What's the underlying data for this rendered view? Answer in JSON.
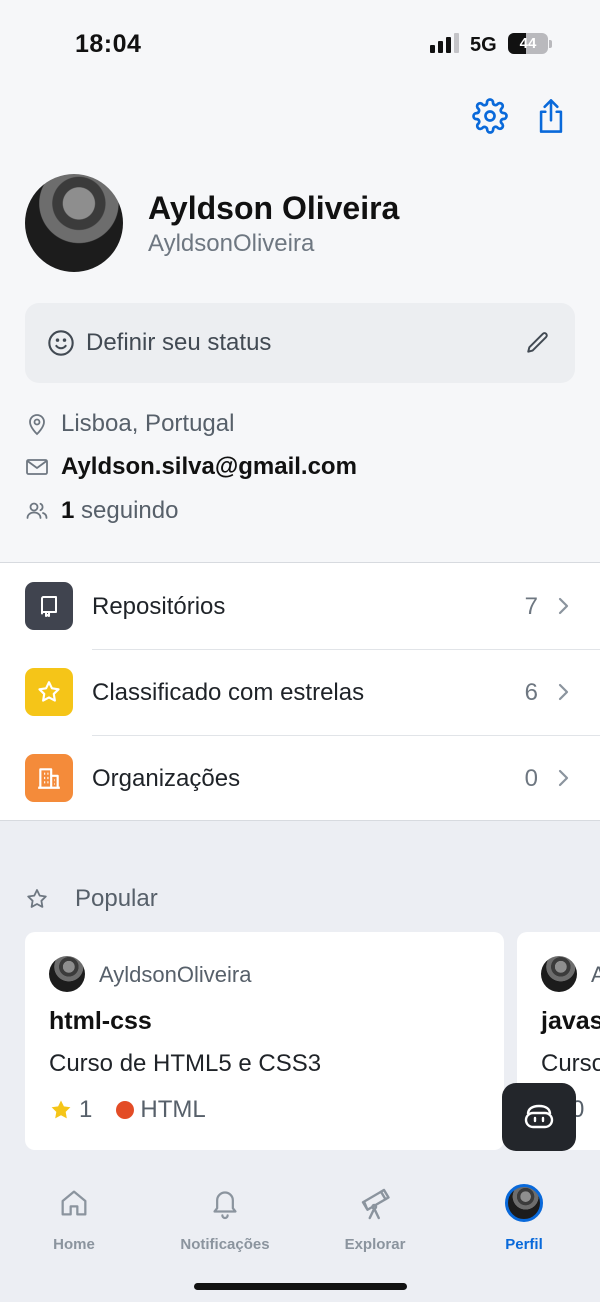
{
  "status_bar": {
    "time": "18:04",
    "network": "5G",
    "battery": "44",
    "battery_level": 0.44
  },
  "colors": {
    "accent": "#0969da",
    "repo_tile": "#40444f",
    "star_tile": "#f5c518",
    "org_tile": "#f48b3a",
    "html_lang": "#e34c26"
  },
  "toolbar": {
    "settings_icon": "gear-icon",
    "share_icon": "share-icon"
  },
  "profile": {
    "name": "Ayldson Oliveira",
    "login": "AyldsonOliveira",
    "status_placeholder": "Definir seu status",
    "location": "Lisboa, Portugal",
    "email": "Ayldson.silva@gmail.com",
    "following_count": "1",
    "following_label": "seguindo"
  },
  "menu": [
    {
      "label": "Repositórios",
      "count": "7",
      "icon": "repo-icon"
    },
    {
      "label": "Classificado com estrelas",
      "count": "6",
      "icon": "star-icon"
    },
    {
      "label": "Organizações",
      "count": "0",
      "icon": "organization-icon"
    }
  ],
  "popular": {
    "title": "Popular",
    "cards": [
      {
        "owner": "AyldsonOliveira",
        "repo": "html-css",
        "description": "Curso de HTML5 e CSS3",
        "stars": "1",
        "language": "HTML"
      },
      {
        "owner": "A",
        "repo": "javas",
        "description": "Curso",
        "stars": "0"
      }
    ]
  },
  "tabs": [
    {
      "label": "Home",
      "icon": "home-icon"
    },
    {
      "label": "Notificações",
      "icon": "bell-icon"
    },
    {
      "label": "Explorar",
      "icon": "telescope-icon"
    },
    {
      "label": "Perfil",
      "icon": "avatar"
    }
  ],
  "active_tab": "Perfil"
}
